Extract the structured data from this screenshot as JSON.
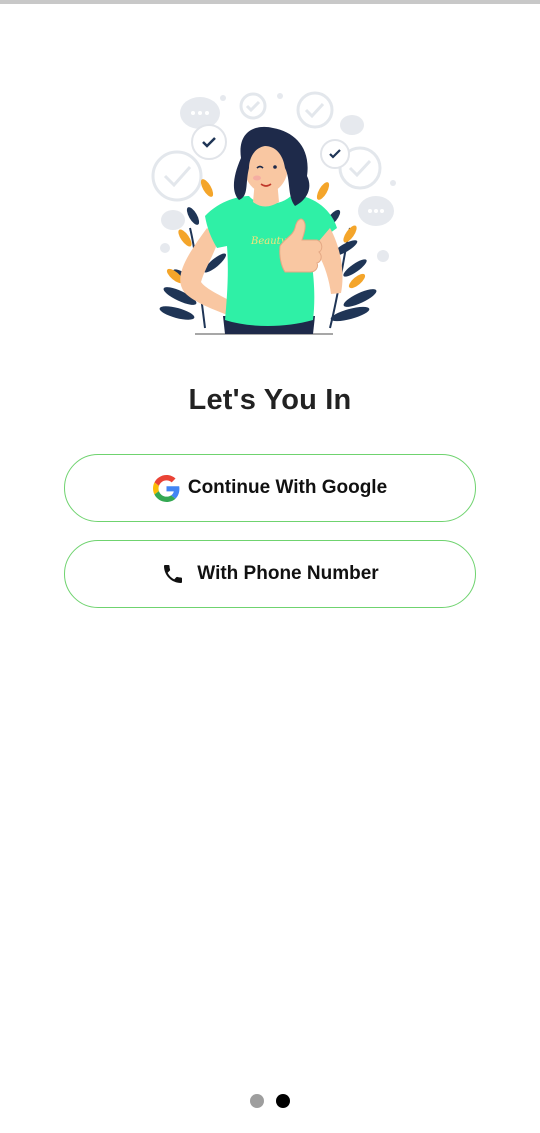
{
  "screen": {
    "heading": "Let's You In"
  },
  "buttons": {
    "google_label": "Continue With Google",
    "phone_label": "With Phone Number"
  },
  "icons": {
    "google": "google-logo-icon",
    "phone": "phone-icon"
  },
  "illustration": {
    "shirt_text": "Beauty"
  },
  "pager": {
    "page_count": 2,
    "active_page": 2
  },
  "colors": {
    "button_border": "#6fd36f",
    "shirt": "#2ff0a6",
    "hair": "#1e2a4a",
    "leaf_dark": "#1f3556",
    "leaf_orange": "#f4a52a",
    "dot_active": "#000000",
    "dot_inactive": "#9e9e9e"
  }
}
